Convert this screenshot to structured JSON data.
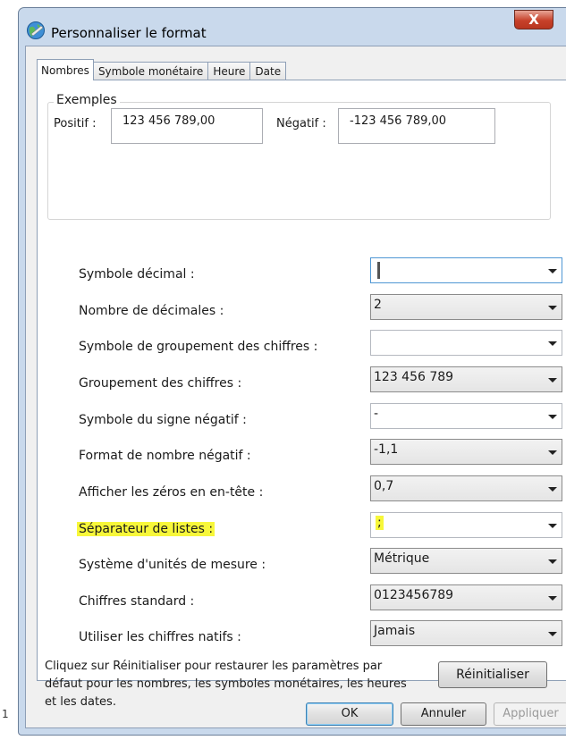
{
  "window": {
    "title": "Personnaliser le format",
    "close_glyph": "X"
  },
  "tabs": [
    {
      "label": "Nombres",
      "active": true
    },
    {
      "label": "Symbole monétaire",
      "active": false
    },
    {
      "label": "Heure",
      "active": false
    },
    {
      "label": "Date",
      "active": false
    }
  ],
  "examples": {
    "group_label": "Exemples",
    "positive_label": "Positif :",
    "positive_value": "123 456 789,00",
    "negative_label": "Négatif :",
    "negative_value": "-123 456 789,00"
  },
  "settings": [
    {
      "label": "Symbole décimal :",
      "value": "",
      "kind": "edit-focus"
    },
    {
      "label": "Nombre de décimales :",
      "value": "2",
      "kind": "ro"
    },
    {
      "label": "Symbole de groupement des chiffres :",
      "value": "",
      "kind": "edit"
    },
    {
      "label": "Groupement des chiffres :",
      "value": "123 456 789",
      "kind": "ro"
    },
    {
      "label": "Symbole du signe négatif :",
      "value": "-",
      "kind": "edit"
    },
    {
      "label": "Format de nombre négatif :",
      "value": "-1,1",
      "kind": "ro"
    },
    {
      "label": "Afficher les zéros en en-tête :",
      "value": "0,7",
      "kind": "ro"
    },
    {
      "label": "Séparateur de listes :",
      "value": ";",
      "kind": "edit",
      "highlighted": true
    },
    {
      "label": "Système d'unités de mesure :",
      "value": "Métrique",
      "kind": "ro"
    },
    {
      "label": "Chiffres standard :",
      "value": "0123456789",
      "kind": "ro"
    },
    {
      "label": "Utiliser les chiffres natifs :",
      "value": "Jamais",
      "kind": "ro"
    }
  ],
  "note": "Cliquez sur Réinitialiser pour restaurer les paramètres par défaut pour les nombres, les symboles monétaires, les heures et les dates.",
  "buttons": {
    "reset": "Réinitialiser",
    "ok": "OK",
    "cancel": "Annuler",
    "apply": "Appliquer"
  },
  "edge_fragment": "1",
  "colors": {
    "highlight": "#f7f73a",
    "close_red": "#c7412a",
    "frame": "#c9d9ec"
  }
}
